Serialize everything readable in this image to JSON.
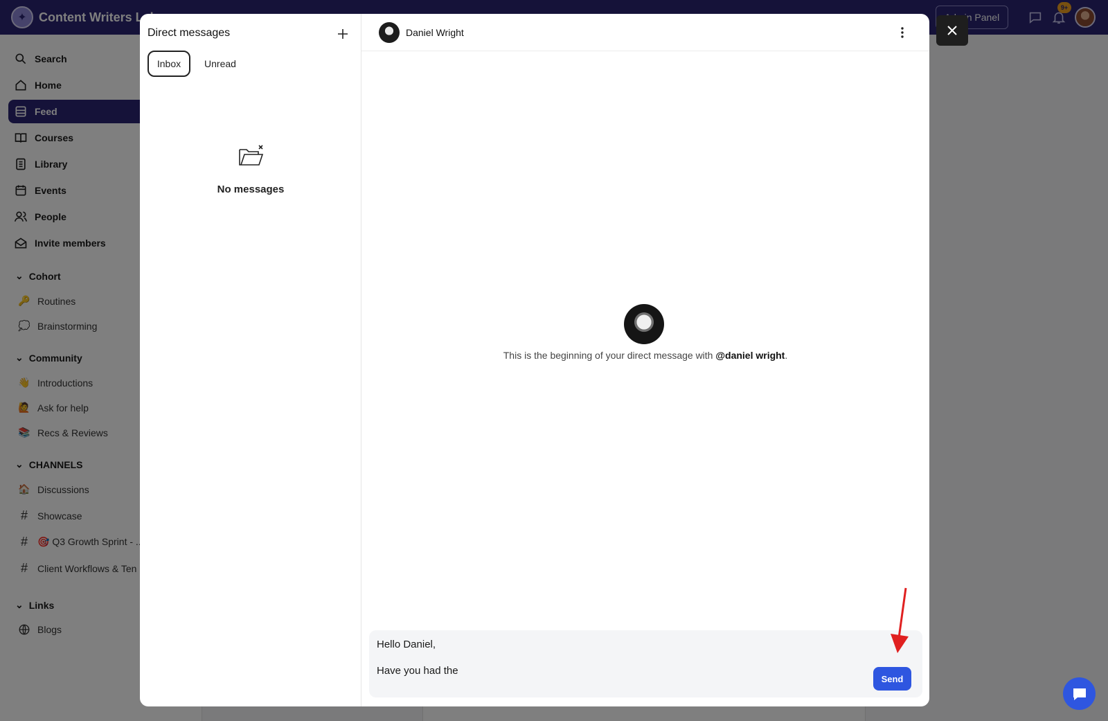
{
  "app": {
    "name": "Content Writers Lab",
    "admin_label": "Admin Panel",
    "notification_count": "9+"
  },
  "sidebar": {
    "nav": [
      {
        "label": "Search",
        "icon": "search-icon"
      },
      {
        "label": "Home",
        "icon": "home-icon"
      },
      {
        "label": "Feed",
        "icon": "feed-icon",
        "active": true
      },
      {
        "label": "Courses",
        "icon": "book-icon"
      },
      {
        "label": "Library",
        "icon": "library-icon"
      },
      {
        "label": "Events",
        "icon": "calendar-icon"
      },
      {
        "label": "People",
        "icon": "people-icon"
      },
      {
        "label": "Invite members",
        "icon": "envelope-icon"
      }
    ],
    "sections": [
      {
        "title": "Cohort",
        "items": [
          {
            "label": "Routines",
            "icon": "🔑"
          },
          {
            "label": "Brainstorming",
            "icon": "💭"
          }
        ]
      },
      {
        "title": "Community",
        "items": [
          {
            "label": "Introductions",
            "icon": "👋"
          },
          {
            "label": "Ask for help",
            "icon": "🙋"
          },
          {
            "label": "Recs & Reviews",
            "icon": "📚"
          }
        ]
      },
      {
        "title": "CHANNELS",
        "items": [
          {
            "label": "Discussions",
            "icon": "🏠"
          },
          {
            "label": "Showcase",
            "icon": "#"
          },
          {
            "label": "🎯 Q3 Growth Sprint - ...",
            "icon": "#"
          },
          {
            "label": "Client Workflows & Ten",
            "icon": "#"
          }
        ]
      },
      {
        "title": "Links",
        "items": [
          {
            "label": "Blogs",
            "icon": "globe-icon"
          }
        ]
      }
    ]
  },
  "dm": {
    "title": "Direct messages",
    "tabs": [
      "Inbox",
      "Unread"
    ],
    "empty_text": "No messages"
  },
  "conversation": {
    "contact_name": "Daniel Wright",
    "intro_prefix": "This is the beginning of your direct message with ",
    "intro_handle": "@daniel wright",
    "intro_suffix": ".",
    "draft_line1": "Hello Daniel,",
    "draft_line2": "Have you had the",
    "send_label": "Send"
  },
  "colors": {
    "brand": "#2a2572",
    "send": "#2e56e0",
    "annotation_arrow": "#e02020"
  }
}
